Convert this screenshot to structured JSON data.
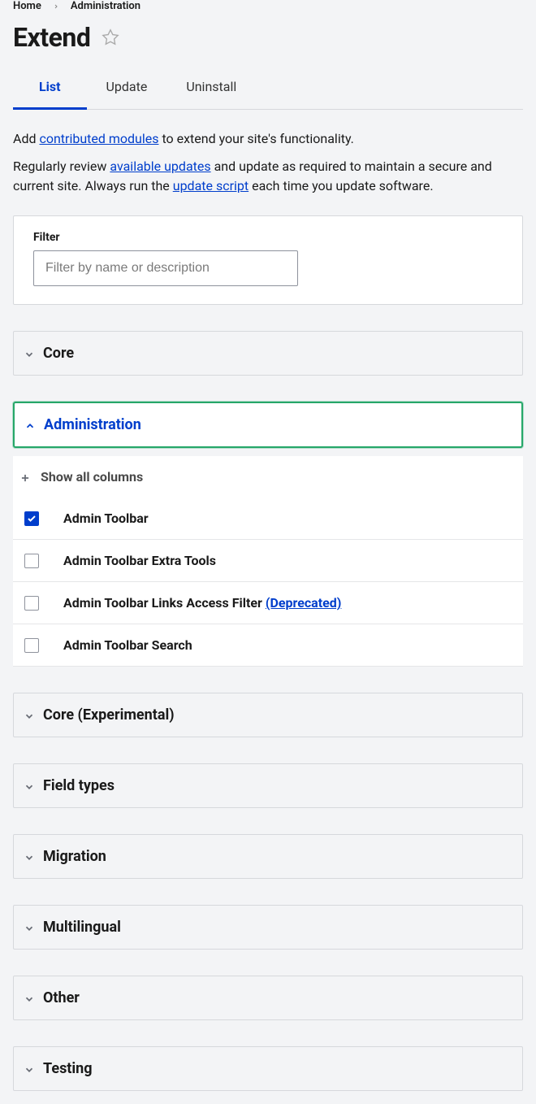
{
  "breadcrumb": {
    "home": "Home",
    "current": "Administration"
  },
  "page_title": "Extend",
  "tabs": [
    {
      "label": "List",
      "active": true
    },
    {
      "label": "Update",
      "active": false
    },
    {
      "label": "Uninstall",
      "active": false
    }
  ],
  "intro": {
    "p1_pre": "Add ",
    "p1_link": "contributed modules",
    "p1_post": " to extend your site's functionality.",
    "p2_pre": "Regularly review ",
    "p2_link1": "available updates",
    "p2_mid": " and update as required to maintain a secure and current site. Always run the ",
    "p2_link2": "update script",
    "p2_post": " each time you update software."
  },
  "filter": {
    "label": "Filter",
    "placeholder": "Filter by name or description"
  },
  "sections": [
    {
      "title": "Core",
      "expanded": false
    },
    {
      "title": "Administration",
      "expanded": true
    },
    {
      "title": "Core (Experimental)",
      "expanded": false
    },
    {
      "title": "Field types",
      "expanded": false
    },
    {
      "title": "Migration",
      "expanded": false
    },
    {
      "title": "Multilingual",
      "expanded": false
    },
    {
      "title": "Other",
      "expanded": false
    },
    {
      "title": "Testing",
      "expanded": false
    }
  ],
  "show_all_columns": "Show all columns",
  "modules": [
    {
      "name": "Admin Toolbar",
      "checked": true,
      "deprecated": null
    },
    {
      "name": "Admin Toolbar Extra Tools",
      "checked": false,
      "deprecated": null
    },
    {
      "name": "Admin Toolbar Links Access Filter ",
      "checked": false,
      "deprecated": "(Deprecated)"
    },
    {
      "name": "Admin Toolbar Search",
      "checked": false,
      "deprecated": null
    }
  ]
}
